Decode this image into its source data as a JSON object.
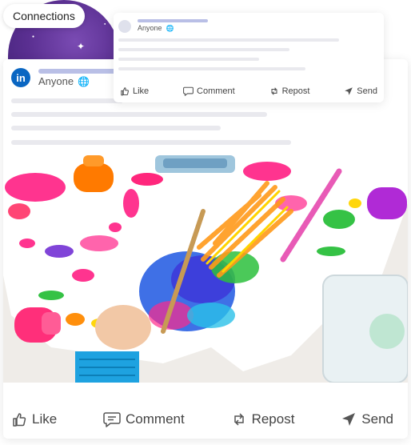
{
  "badge": {
    "label": "Connections"
  },
  "mini_post": {
    "visibility": "Anyone",
    "actions": {
      "like": "Like",
      "comment": "Comment",
      "repost": "Repost",
      "send": "Send"
    }
  },
  "main_post": {
    "brand_logo": "in",
    "visibility": "Anyone",
    "actions": {
      "like": "Like",
      "comment": "Comment",
      "repost": "Repost",
      "send": "Send"
    }
  },
  "icons": [
    "globe-icon",
    "like-icon",
    "comment-icon",
    "repost-icon",
    "send-icon",
    "linkedin-logo"
  ],
  "colors": {
    "brand_blue": "#0a66c2",
    "name_placeholder": "#b9bfe6",
    "sky_purple": "#5a2f91"
  }
}
